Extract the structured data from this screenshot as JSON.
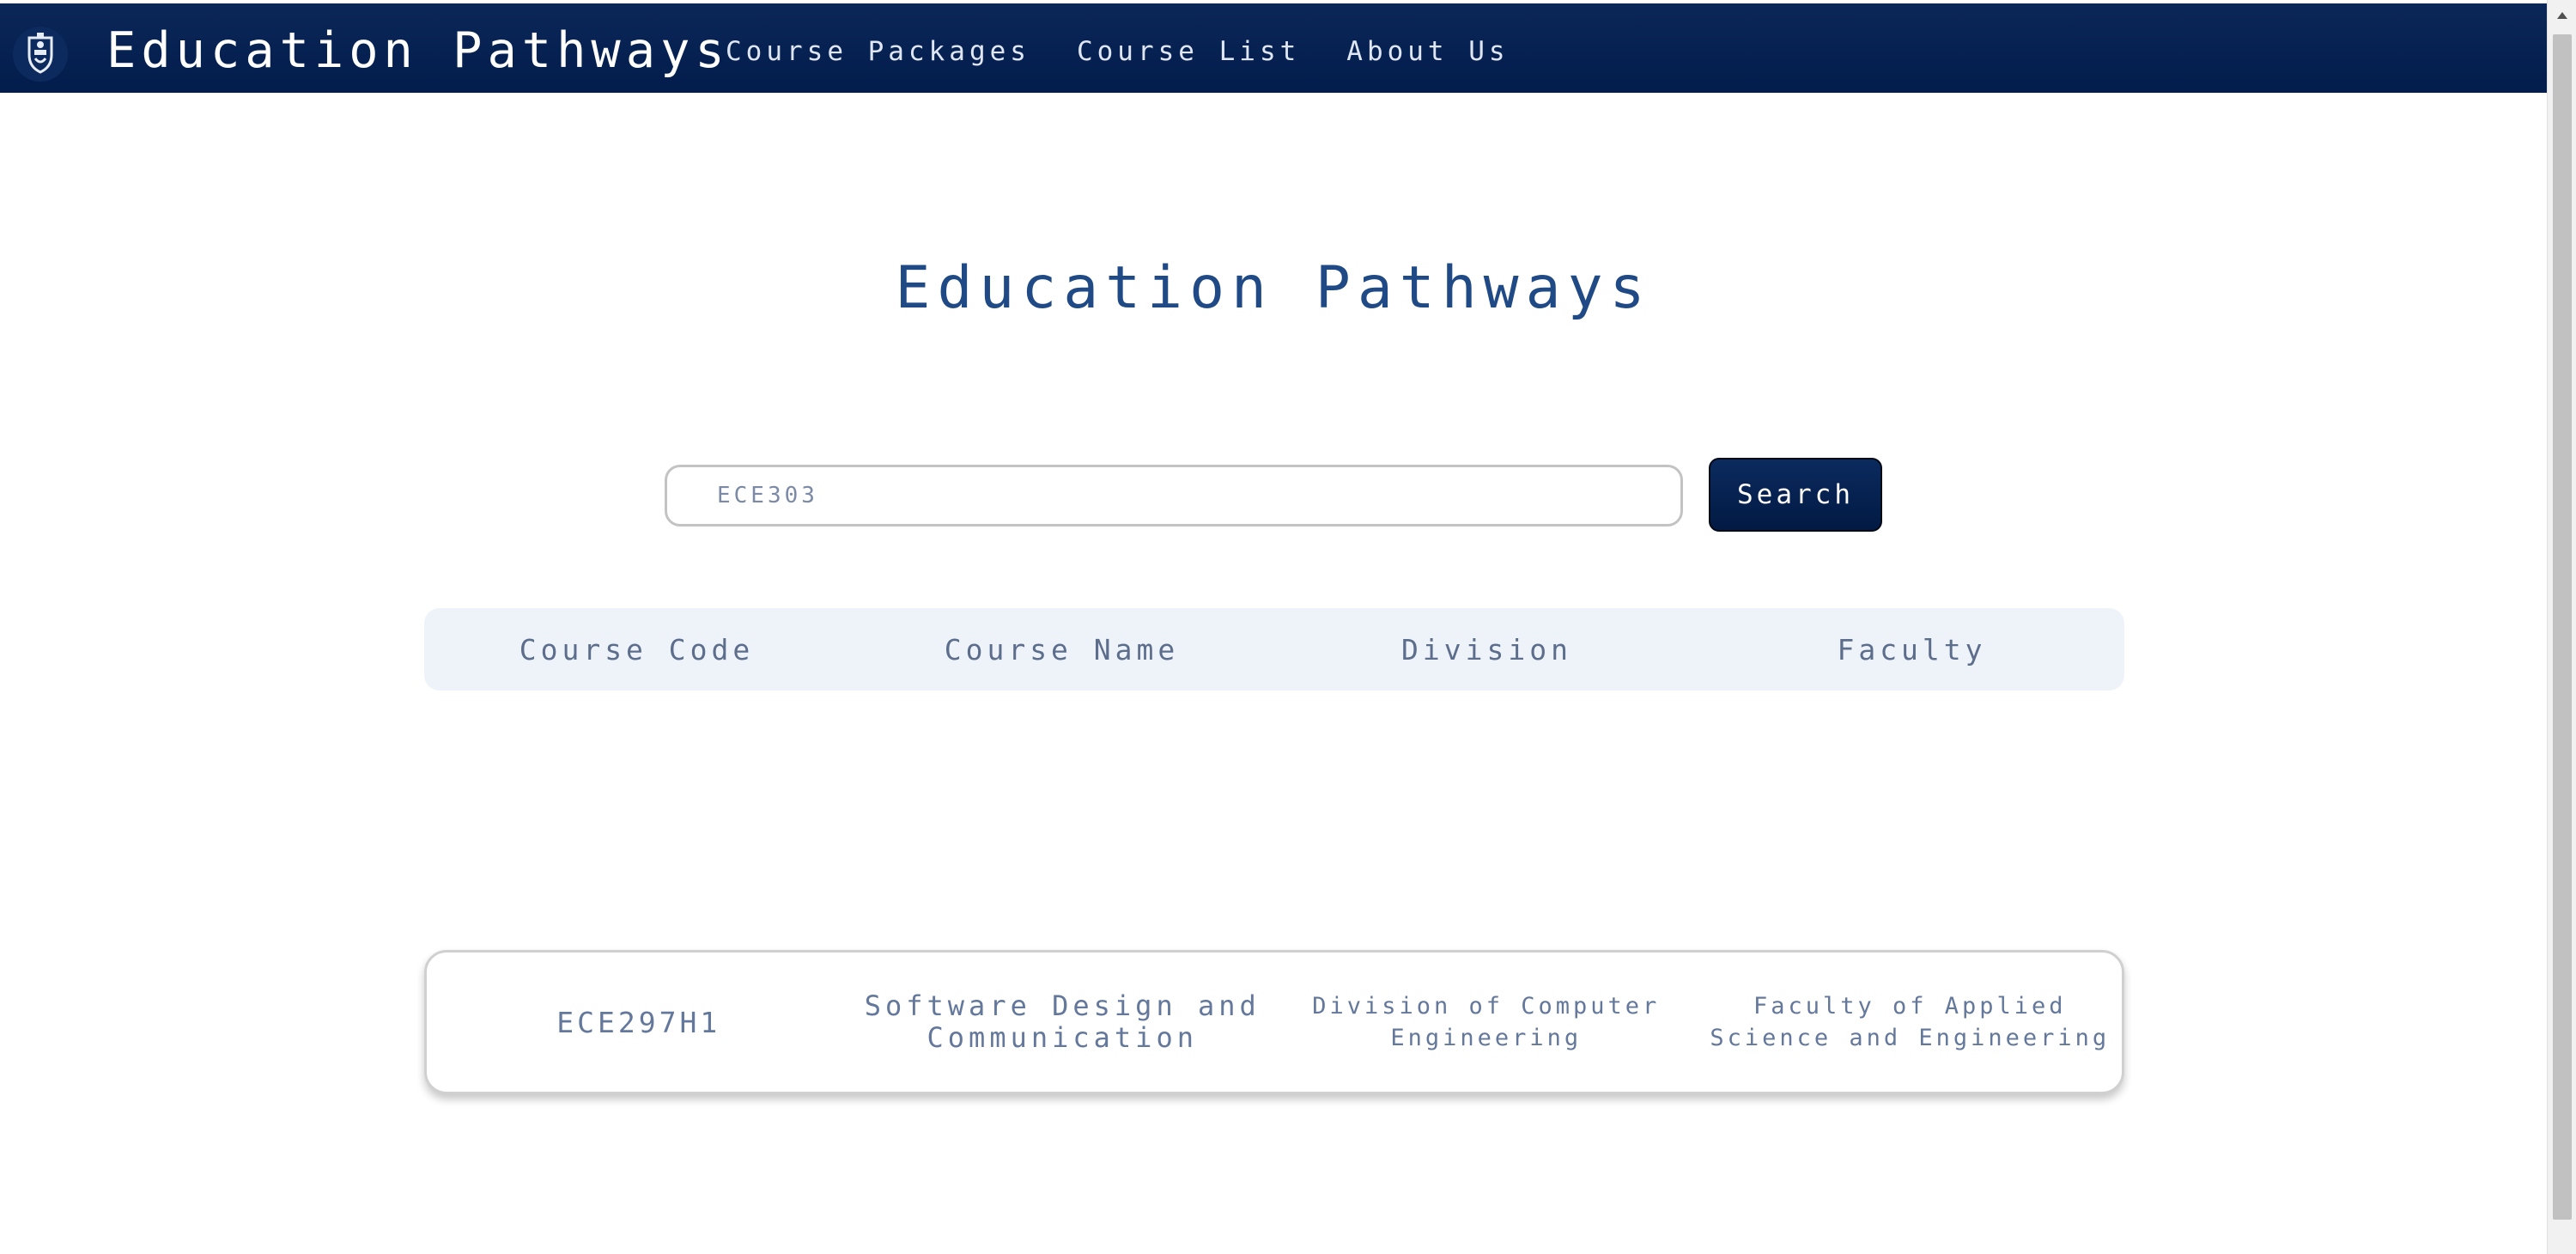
{
  "navbar": {
    "brand": "Education Pathways",
    "links": [
      "Course Packages",
      "Course List",
      "About Us"
    ]
  },
  "main": {
    "title": "Education Pathways"
  },
  "search": {
    "value": "ECE303",
    "button_label": "Search"
  },
  "table": {
    "headers": [
      "Course Code",
      "Course Name",
      "Division",
      "Faculty"
    ]
  },
  "results": [
    {
      "code": "ECE297H1",
      "name": "Software Design and Communication",
      "division": "Division of Computer Engineering",
      "faculty": "Faculty of Applied Science and Engineering"
    }
  ],
  "colors": {
    "navbar": "#021d4c",
    "title": "#1f4a85",
    "header_bg": "#eef3fa",
    "text_muted": "#64789b"
  }
}
